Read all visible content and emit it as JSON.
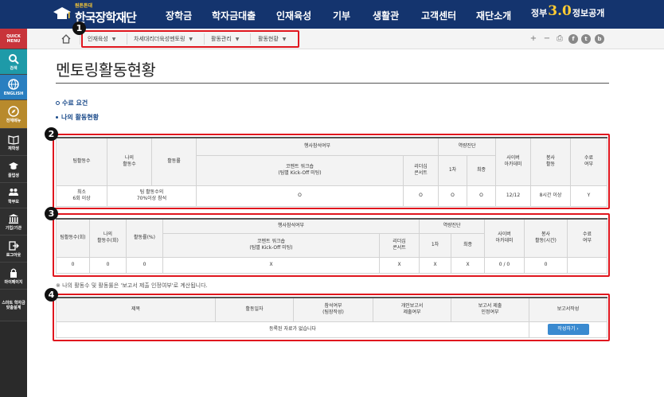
{
  "header": {
    "logo_small": "원튼튼대",
    "logo_title": "한국장학재단",
    "nav": [
      "장학금",
      "학자금대출",
      "인재육성",
      "기부",
      "생활관",
      "고객센터",
      "재단소개"
    ],
    "gov_prefix": "정부",
    "gov_three": "3.0",
    "gov_suffix": "정보공개"
  },
  "sidebar": {
    "items": [
      {
        "label": "QUICK MENU",
        "icon": "menu-icon"
      },
      {
        "label": "검색",
        "icon": "search-icon"
      },
      {
        "label": "ENGLISH",
        "icon": "globe-icon"
      },
      {
        "label": "전체메뉴",
        "icon": "compass-icon"
      },
      {
        "label": "재학생",
        "icon": "book-icon"
      },
      {
        "label": "졸업생",
        "icon": "graduation-cap-icon"
      },
      {
        "label": "학부모",
        "icon": "parents-icon"
      },
      {
        "label": "기업/기관",
        "icon": "institution-icon"
      },
      {
        "label": "로그아웃",
        "icon": "logout-icon"
      },
      {
        "label": "마이페이지",
        "icon": "lock-icon"
      },
      {
        "label": "스마트 학자금 맞춤설계",
        "icon": "smart-icon"
      }
    ]
  },
  "breadcrumb": {
    "items": [
      "인재육성",
      "차세대리더육성멘토링",
      "활동관리",
      "활동현황"
    ],
    "marker": "1"
  },
  "toolbar": {
    "plus": "+",
    "minus": "−",
    "print": "⎙",
    "f": "f",
    "t": "t",
    "b": "b"
  },
  "page": {
    "title": "멘토링활동현황",
    "link_requirements": "수료 요건",
    "link_my_activity": "나의 활동현황"
  },
  "markers": {
    "m2": "2",
    "m3": "3",
    "m4": "4"
  },
  "table_requirements": {
    "headers": {
      "team_count": "팀활동수",
      "my_count": "나의\n활동수",
      "rate": "활동률",
      "event": "행사참석여부",
      "competency": "역량진단",
      "cyber": "사이버\n아카데미",
      "service": "봉사\n활동",
      "complete": "수료\n여부",
      "workshop": "코멘트 워크숍\n(팀별 Kick-Off 미팅)",
      "leadership": "리더십\n콘서트",
      "first": "1차",
      "final": "최종"
    },
    "row": {
      "team_count": "최소\n6회 이상",
      "rate": "팀 활동수의\n70%이상 참석",
      "workshop": "O",
      "leadership": "O",
      "first": "O",
      "final": "O",
      "cyber": "12/12",
      "service": "8시간 이상",
      "complete": "Y"
    }
  },
  "table_status": {
    "headers": {
      "team_count": "팀활동수(회)",
      "my_count": "나의\n활동수(회)",
      "rate": "활동률(%)",
      "event": "행사참석여부",
      "competency": "역량진단",
      "cyber": "사이버\n아카데미",
      "service": "봉사\n활동(시간)",
      "complete": "수료\n여부",
      "workshop": "코멘트 워크숍\n(팀별 Kick-Off 미팅)",
      "leadership": "리더십\n콘서트",
      "first": "1차",
      "final": "최종"
    },
    "row": {
      "team_count": "0",
      "my_count": "0",
      "rate": "0",
      "workshop": "X",
      "leadership": "X",
      "first": "X",
      "final": "X",
      "cyber": "0 / 0",
      "service": "0",
      "complete": ""
    }
  },
  "note": "※ 나의 활동수 및 활동률은 '보고서 제출 인정여부'로 계산됩니다.",
  "table_reports": {
    "headers": [
      "제목",
      "활동일자",
      "참석여부\n(팀장작성)",
      "개인보고서\n제출여부",
      "보고서 제출\n인정여부",
      "보고서작성"
    ],
    "empty": "등록된 자료가 없습니다",
    "write_button": "작성하기 ›"
  }
}
